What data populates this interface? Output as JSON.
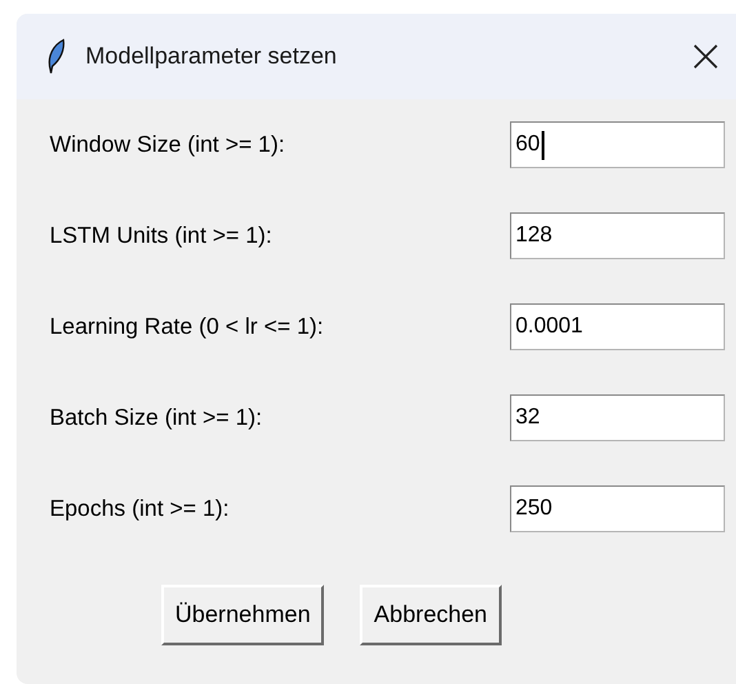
{
  "window": {
    "title": "Modellparameter setzen"
  },
  "fields": [
    {
      "label": "Window Size (int >= 1):",
      "value": "60",
      "focused": true
    },
    {
      "label": "LSTM Units (int >= 1):",
      "value": "128",
      "focused": false
    },
    {
      "label": "Learning Rate (0 < lr <= 1):",
      "value": "0.0001",
      "focused": false
    },
    {
      "label": "Batch Size (int >= 1):",
      "value": "32",
      "focused": false
    },
    {
      "label": "Epochs (int >= 1):",
      "value": "250",
      "focused": false
    }
  ],
  "buttons": [
    "Übernehmen",
    "Abbrechen"
  ]
}
